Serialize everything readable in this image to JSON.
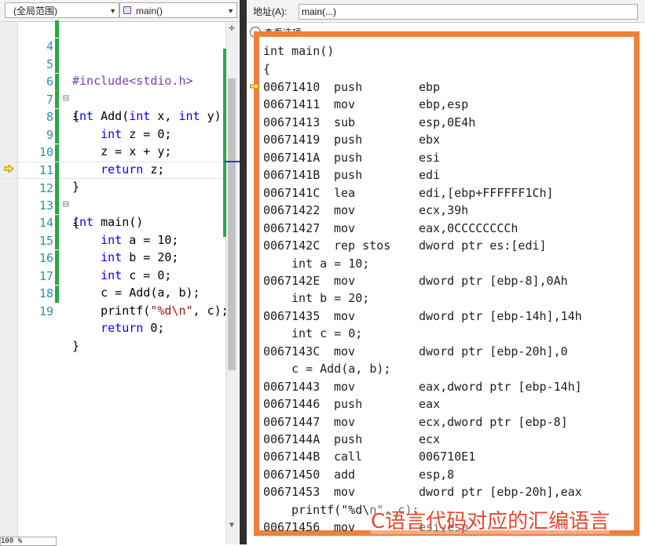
{
  "left_editor": {
    "scope_combo": "(全局范围)",
    "function_combo": "main()",
    "lines": [
      {
        "num": "4",
        "text": "#include<stdio.h>"
      },
      {
        "num": "5",
        "text": "int Add(int x, int y)"
      },
      {
        "num": "6",
        "text": "{"
      },
      {
        "num": "7",
        "text": "    int z = 0;"
      },
      {
        "num": "8",
        "text": "    z = x + y;"
      },
      {
        "num": "9",
        "text": "    return z;"
      },
      {
        "num": "10",
        "text": "}"
      },
      {
        "num": "11",
        "text": "int main()"
      },
      {
        "num": "12",
        "text": "{"
      },
      {
        "num": "13",
        "text": "    int a = 10;"
      },
      {
        "num": "14",
        "text": "    int b = 20;"
      },
      {
        "num": "15",
        "text": "    int c = 0;"
      },
      {
        "num": "16",
        "text": "    c = Add(a, b);"
      },
      {
        "num": "17",
        "text": "    printf(\"%d\\n\", c);"
      },
      {
        "num": "18",
        "text": "    return 0;"
      },
      {
        "num": "19",
        "text": "}"
      }
    ],
    "zoom": "100 %"
  },
  "disassembly": {
    "address_label": "地址(A):",
    "address_value": "main(...)",
    "view_options": "查看选项",
    "header_lines": [
      "int main()",
      "{"
    ],
    "rows": [
      {
        "kind": "asm",
        "addr": "00671410",
        "mn": "push",
        "op": "ebp"
      },
      {
        "kind": "asm",
        "addr": "00671411",
        "mn": "mov",
        "op": "ebp,esp"
      },
      {
        "kind": "asm",
        "addr": "00671413",
        "mn": "sub",
        "op": "esp,0E4h"
      },
      {
        "kind": "asm",
        "addr": "00671419",
        "mn": "push",
        "op": "ebx"
      },
      {
        "kind": "asm",
        "addr": "0067141A",
        "mn": "push",
        "op": "esi"
      },
      {
        "kind": "asm",
        "addr": "0067141B",
        "mn": "push",
        "op": "edi"
      },
      {
        "kind": "asm",
        "addr": "0067141C",
        "mn": "lea",
        "op": "edi,[ebp+FFFFFF1Ch]"
      },
      {
        "kind": "asm",
        "addr": "00671422",
        "mn": "mov",
        "op": "ecx,39h"
      },
      {
        "kind": "asm",
        "addr": "00671427",
        "mn": "mov",
        "op": "eax,0CCCCCCCCh"
      },
      {
        "kind": "asm",
        "addr": "0067142C",
        "mn": "rep stos",
        "op": "dword ptr es:[edi]"
      },
      {
        "kind": "src",
        "text": "int a = 10;"
      },
      {
        "kind": "asm",
        "addr": "0067142E",
        "mn": "mov",
        "op": "dword ptr [ebp-8],0Ah"
      },
      {
        "kind": "src",
        "text": "int b = 20;"
      },
      {
        "kind": "asm",
        "addr": "00671435",
        "mn": "mov",
        "op": "dword ptr [ebp-14h],14h"
      },
      {
        "kind": "src",
        "text": "int c = 0;"
      },
      {
        "kind": "asm",
        "addr": "0067143C",
        "mn": "mov",
        "op": "dword ptr [ebp-20h],0"
      },
      {
        "kind": "src",
        "text": "c = Add(a, b);"
      },
      {
        "kind": "asm",
        "addr": "00671443",
        "mn": "mov",
        "op": "eax,dword ptr [ebp-14h]"
      },
      {
        "kind": "asm",
        "addr": "00671446",
        "mn": "push",
        "op": "eax"
      },
      {
        "kind": "asm",
        "addr": "00671447",
        "mn": "mov",
        "op": "ecx,dword ptr [ebp-8]"
      },
      {
        "kind": "asm",
        "addr": "0067144A",
        "mn": "push",
        "op": "ecx"
      },
      {
        "kind": "asm",
        "addr": "0067144B",
        "mn": "call",
        "op": "006710E1"
      },
      {
        "kind": "asm",
        "addr": "00671450",
        "mn": "add",
        "op": "esp,8"
      },
      {
        "kind": "asm",
        "addr": "00671453",
        "mn": "mov",
        "op": "dword ptr [ebp-20h],eax"
      },
      {
        "kind": "src",
        "text": "printf(\"%d\\n\", c);"
      },
      {
        "kind": "asm",
        "addr": "00671456",
        "mn": "mov",
        "op": "esi,esp"
      }
    ],
    "caption": "C语言代码对应的汇编语言"
  },
  "colors": {
    "highlight_border": "#f07f3c",
    "caption": "#e8482c",
    "line_number": "#2b91af",
    "keyword": "#0000ff",
    "change_bar": "#2aa846"
  }
}
